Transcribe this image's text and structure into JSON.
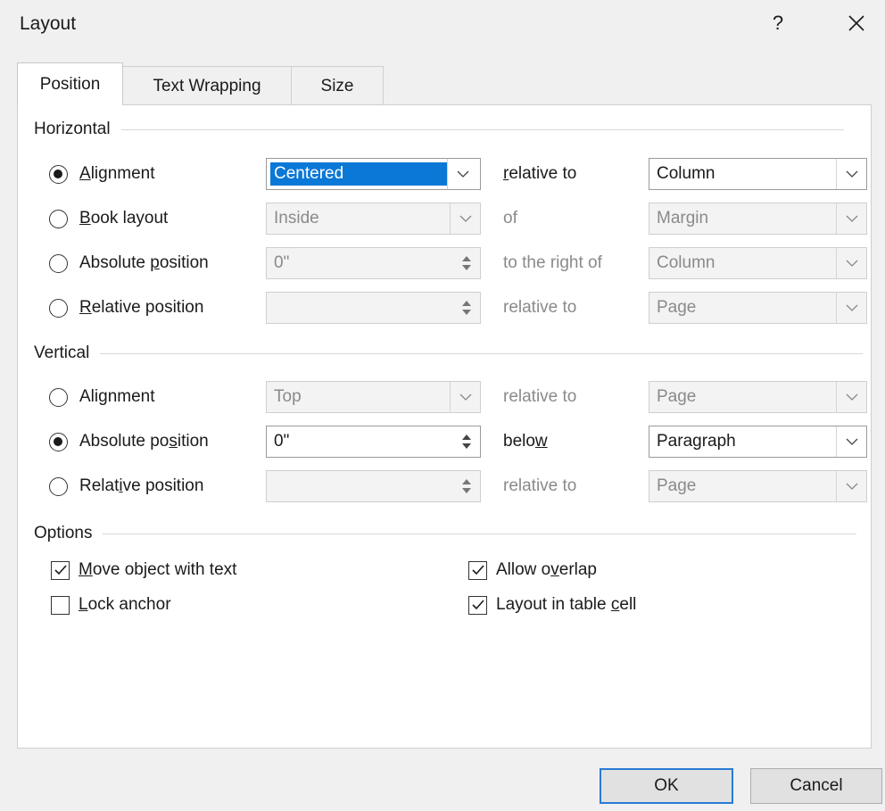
{
  "dialog": {
    "title": "Layout",
    "help": "?"
  },
  "tabs": [
    {
      "label": "Position",
      "active": true
    },
    {
      "label": "Text Wrapping",
      "active": false
    },
    {
      "label": "Size",
      "active": false
    }
  ],
  "horizontal": {
    "title": "Horizontal",
    "rows": [
      {
        "radio_label": [
          "",
          "A",
          "lignment"
        ],
        "checked": true,
        "value": "Centered",
        "control": "dropdown",
        "enabled": true,
        "rel_label": [
          "",
          "r",
          "elative to"
        ],
        "rel_value": "Column",
        "rel_enabled": true
      },
      {
        "radio_label": [
          "",
          "B",
          "ook layout"
        ],
        "checked": false,
        "value": "Inside",
        "control": "dropdown",
        "enabled": false,
        "rel_label": [
          "of",
          "",
          ""
        ],
        "rel_value": "Margin",
        "rel_enabled": false
      },
      {
        "radio_label": [
          "Absolute ",
          "p",
          "osition"
        ],
        "checked": false,
        "value": "0\"",
        "control": "spin",
        "enabled": false,
        "rel_label": [
          "to the right of",
          "",
          ""
        ],
        "rel_value": "Column",
        "rel_enabled": false
      },
      {
        "radio_label": [
          "",
          "R",
          "elative position"
        ],
        "checked": false,
        "value": "",
        "control": "spin",
        "enabled": false,
        "rel_label": [
          "relative to",
          "",
          ""
        ],
        "rel_value": "Page",
        "rel_enabled": false
      }
    ]
  },
  "vertical": {
    "title": "Vertical",
    "rows": [
      {
        "radio_label": [
          "Ali",
          "g",
          "nment"
        ],
        "checked": false,
        "value": "Top",
        "control": "dropdown",
        "enabled": false,
        "rel_label": [
          "relative to",
          "",
          ""
        ],
        "rel_value": "Page",
        "rel_enabled": false
      },
      {
        "radio_label": [
          "Absolute po",
          "s",
          "ition"
        ],
        "checked": true,
        "value": "0\"",
        "control": "spin",
        "enabled": true,
        "rel_label": [
          "belo",
          "w",
          ""
        ],
        "rel_value": "Paragraph",
        "rel_enabled": true
      },
      {
        "radio_label": [
          "Relat",
          "i",
          "ve position"
        ],
        "checked": false,
        "value": "",
        "control": "spin",
        "enabled": false,
        "rel_label": [
          "relative to",
          "",
          ""
        ],
        "rel_value": "Page",
        "rel_enabled": false
      }
    ]
  },
  "options": {
    "title": "Options",
    "move_with_text": {
      "pre": "",
      "key": "M",
      "post": "ove object with text",
      "checked": true
    },
    "lock_anchor": {
      "pre": "",
      "key": "L",
      "post": "ock anchor",
      "checked": false
    },
    "allow_overlap": {
      "pre": "Allow o",
      "key": "v",
      "post": "erlap",
      "checked": true
    },
    "layout_in_cell": {
      "pre": "Layout in table ",
      "key": "c",
      "post": "ell",
      "checked": true
    }
  },
  "buttons": {
    "ok": "OK",
    "cancel": "Cancel"
  }
}
